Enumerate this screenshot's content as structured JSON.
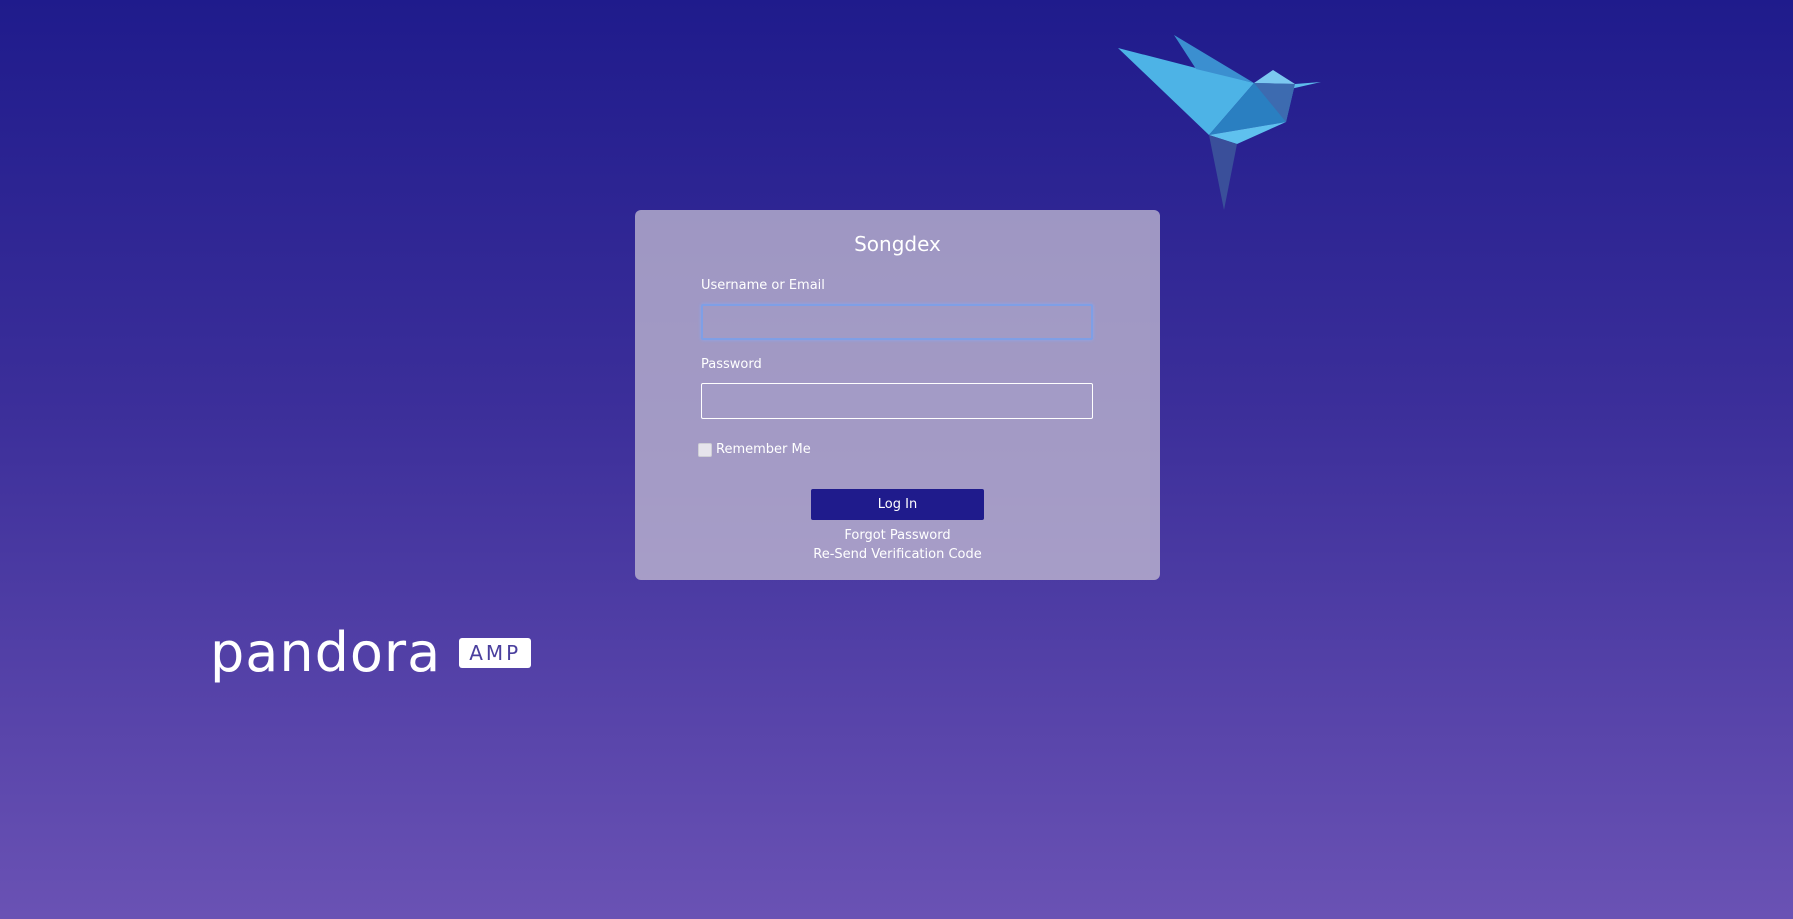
{
  "login_card": {
    "title": "Songdex",
    "username_label": "Username or Email",
    "username_value": "",
    "password_label": "Password",
    "password_value": "",
    "remember_label": "Remember Me",
    "remember_checked": false,
    "login_button": "Log In",
    "forgot_link": "Forgot Password",
    "resend_link": "Re-Send Verification Code"
  },
  "branding": {
    "logo_word": "pandora",
    "badge": "AMP",
    "bird_icon": "origami-bird-icon"
  },
  "colors": {
    "accent": "#1f1b8c",
    "bird_light": "#4db3e6",
    "bird_dark": "#2a7fc1"
  }
}
